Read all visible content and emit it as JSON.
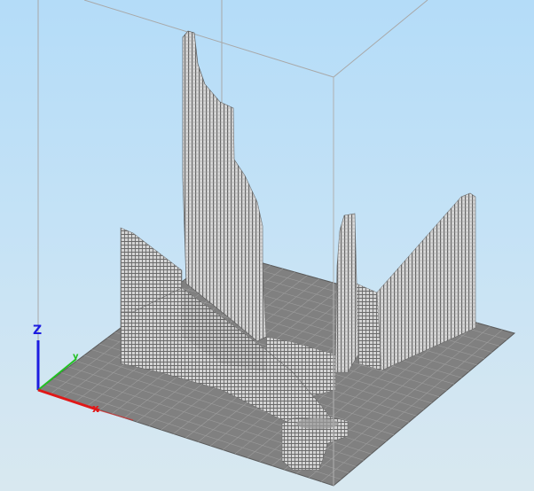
{
  "scene": {
    "background_top": "#b4dcf8",
    "background_bottom": "#d8e8f0",
    "build_plate_color": "#808080",
    "grid_line_color": "#9c9c9c",
    "model_fill_color": "#d6d6d6",
    "model_line_color": "#686868",
    "build_volume_edge_color": "#a8a8a8"
  },
  "axes": {
    "x": {
      "label": "x",
      "color": "#e01818"
    },
    "y": {
      "label": "y",
      "color": "#22c022"
    },
    "z": {
      "label": "Z",
      "color": "#1c1ce0"
    }
  }
}
